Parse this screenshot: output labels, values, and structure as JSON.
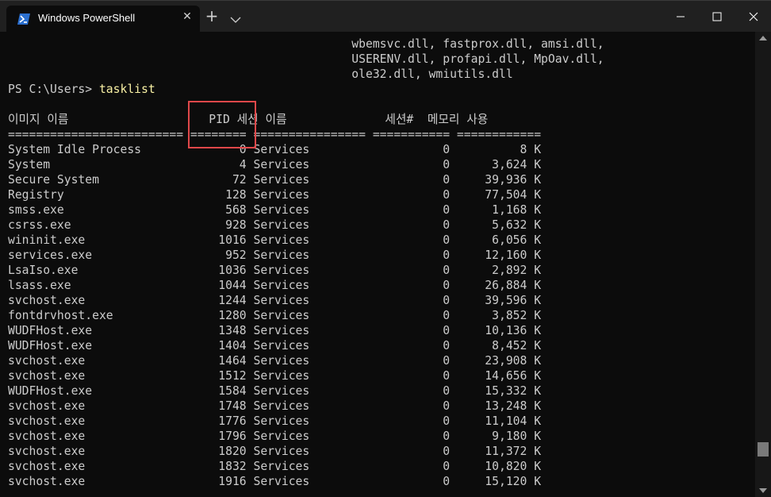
{
  "titlebar": {
    "tab_title": "Windows PowerShell",
    "close_tab_glyph": "✕",
    "new_tab_glyph": "+"
  },
  "terminal": {
    "module_lines": [
      "                                                 wbemsvc.dll, fastprox.dll, amsi.dll,",
      "                                                 USERENV.dll, profapi.dll, MpOav.dll,",
      "                                                 ole32.dll, wmiutils.dll"
    ],
    "prompt": "PS C:\\Users> ",
    "command": "tasklist",
    "header": "이미지 이름                    PID 세션 이름              세션#  메모리 사용",
    "separator": "========================= ======== ================ =========== ============",
    "rows": [
      "System Idle Process              0 Services                   0          8 K",
      "System                           4 Services                   0      3,624 K",
      "Secure System                   72 Services                   0     39,936 K",
      "Registry                       128 Services                   0     77,504 K",
      "smss.exe                       568 Services                   0      1,168 K",
      "csrss.exe                      928 Services                   0      5,632 K",
      "wininit.exe                   1016 Services                   0      6,056 K",
      "services.exe                   952 Services                   0     12,160 K",
      "LsaIso.exe                    1036 Services                   0      2,892 K",
      "lsass.exe                     1044 Services                   0     26,884 K",
      "svchost.exe                   1244 Services                   0     39,596 K",
      "fontdrvhost.exe               1280 Services                   0      3,852 K",
      "WUDFHost.exe                  1348 Services                   0     10,136 K",
      "WUDFHost.exe                  1404 Services                   0      8,452 K",
      "svchost.exe                   1464 Services                   0     23,908 K",
      "svchost.exe                   1512 Services                   0     14,656 K",
      "WUDFHost.exe                  1584 Services                   0     15,332 K",
      "svchost.exe                   1748 Services                   0     13,248 K",
      "svchost.exe                   1776 Services                   0     11,104 K",
      "svchost.exe                   1796 Services                   0      9,180 K",
      "svchost.exe                   1820 Services                   0     11,372 K",
      "svchost.exe                   1832 Services                   0     10,820 K",
      "svchost.exe                   1916 Services                   0     15,120 K"
    ]
  },
  "colors": {
    "background": "#0c0c0c",
    "text": "#cccccc",
    "command": "#f9f1a5",
    "highlight_box": "#e0484a"
  },
  "icons": [
    "powershell-icon",
    "close-tab-icon",
    "new-tab-icon",
    "dropdown-icon",
    "minimize-icon",
    "maximize-icon",
    "close-window-icon"
  ]
}
